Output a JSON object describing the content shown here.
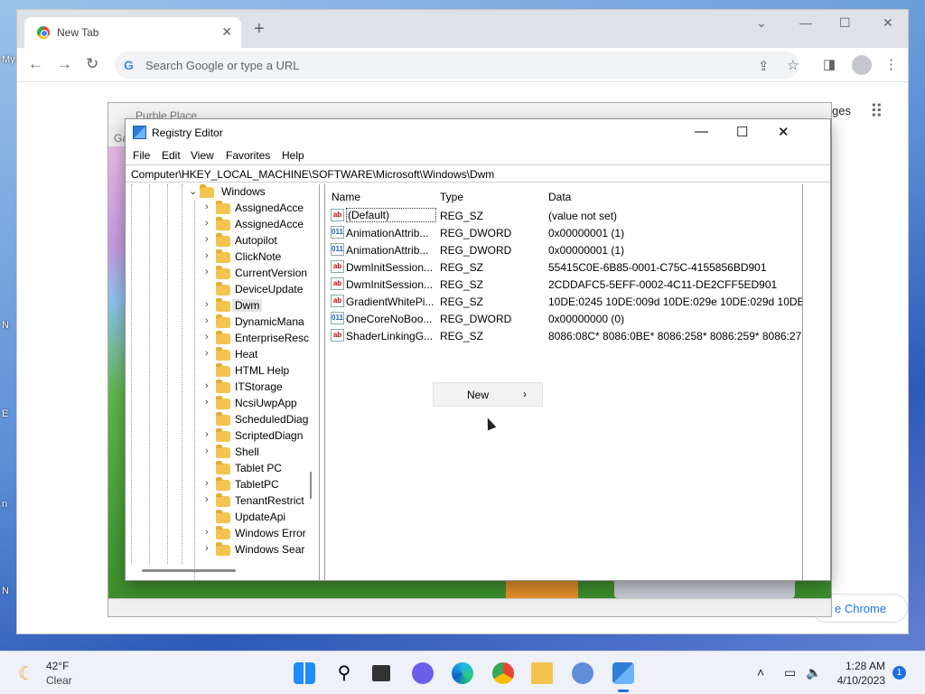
{
  "desktop": {
    "edge_labels": [
      "My",
      "N",
      "E",
      "n",
      "N"
    ]
  },
  "chrome": {
    "tab_title": "New Tab",
    "omnibox_placeholder": "Search Google or type a URL",
    "images_link": "ges",
    "customize_button": "e Chrome"
  },
  "purble": {
    "title": "Purble Place",
    "menu": "Ga"
  },
  "regedit": {
    "title": "Registry Editor",
    "menu": [
      "File",
      "Edit",
      "View",
      "Favorites",
      "Help"
    ],
    "address": "Computer\\HKEY_LOCAL_MACHINE\\SOFTWARE\\Microsoft\\Windows\\Dwm",
    "tree": [
      {
        "label": "Windows",
        "expanded": true
      },
      {
        "label": "AssignedAcce"
      },
      {
        "label": "AssignedAcce"
      },
      {
        "label": "Autopilot"
      },
      {
        "label": "ClickNote"
      },
      {
        "label": "CurrentVersion"
      },
      {
        "label": "DeviceUpdate"
      },
      {
        "label": "Dwm",
        "selected": true
      },
      {
        "label": "DynamicMana"
      },
      {
        "label": "EnterpriseResc"
      },
      {
        "label": "Heat"
      },
      {
        "label": "HTML Help"
      },
      {
        "label": "ITStorage"
      },
      {
        "label": "NcsiUwpApp"
      },
      {
        "label": "ScheduledDiag"
      },
      {
        "label": "ScriptedDiagn"
      },
      {
        "label": "Shell"
      },
      {
        "label": "Tablet PC"
      },
      {
        "label": "TabletPC"
      },
      {
        "label": "TenantRestrict"
      },
      {
        "label": "UpdateApi"
      },
      {
        "label": "Windows Error"
      },
      {
        "label": "Windows Sear"
      }
    ],
    "columns": {
      "name": "Name",
      "type": "Type",
      "data": "Data"
    },
    "values": [
      {
        "name": "(Default)",
        "type": "REG_SZ",
        "data": "(value not set)",
        "icon": "ab"
      },
      {
        "name": "AnimationAttrib...",
        "type": "REG_DWORD",
        "data": "0x00000001 (1)",
        "icon": "011"
      },
      {
        "name": "AnimationAttrib...",
        "type": "REG_DWORD",
        "data": "0x00000001 (1)",
        "icon": "011"
      },
      {
        "name": "DwmInitSession...",
        "type": "REG_SZ",
        "data": "55415C0E-6B85-0001-C75C-4155856BD901",
        "icon": "ab"
      },
      {
        "name": "DwmInitSession...",
        "type": "REG_SZ",
        "data": "2CDDAFC5-5EFF-0002-4C11-DE2CFF5ED901",
        "icon": "ab"
      },
      {
        "name": "GradientWhitePi...",
        "type": "REG_SZ",
        "data": "10DE:0245 10DE:009d 10DE:029e 10DE:029d 10DE:02...",
        "icon": "ab"
      },
      {
        "name": "OneCoreNoBoo...",
        "type": "REG_DWORD",
        "data": "0x00000000 (0)",
        "icon": "011"
      },
      {
        "name": "ShaderLinkingG...",
        "type": "REG_SZ",
        "data": "8086:08C* 8086:0BE* 8086:258* 8086:259* 8086:277*...",
        "icon": "ab"
      }
    ],
    "context_menu": {
      "item": "New",
      "arrow": "›"
    }
  },
  "taskbar": {
    "temperature": "42°F",
    "condition": "Clear",
    "time": "1:28 AM",
    "date": "4/10/2023",
    "notifications": "1"
  },
  "colors": {
    "accent": "#1f6fe0",
    "folder": "#f3c44f",
    "selection": "#e5e5e5"
  }
}
